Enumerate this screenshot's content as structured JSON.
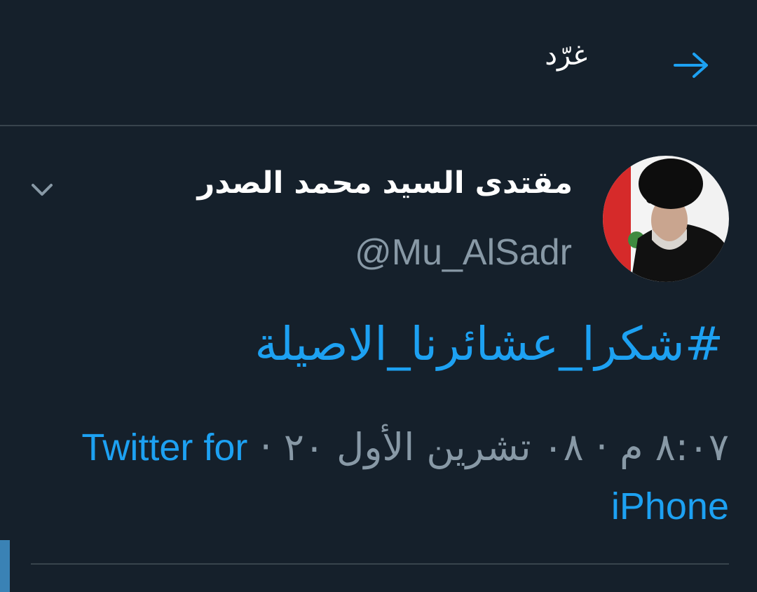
{
  "header": {
    "title": "غرّد",
    "back_icon": "arrow-right-icon"
  },
  "tweet": {
    "display_name": "مقتدى السيد محمد الصدر",
    "handle": "@Mu_AlSadr",
    "menu_icon": "chevron-down-icon",
    "text": "#شكرا_عشائرنا_الاصيلة",
    "timestamp": "٨:٠٧ م · ٠٨ تشرين الأول ٢٠ ·",
    "source_part1": "Twitter for",
    "source_part2": "iPhone"
  },
  "colors": {
    "background": "#15202b",
    "accent": "#1da1f2",
    "muted": "#8899a6",
    "divider": "#38444d"
  }
}
